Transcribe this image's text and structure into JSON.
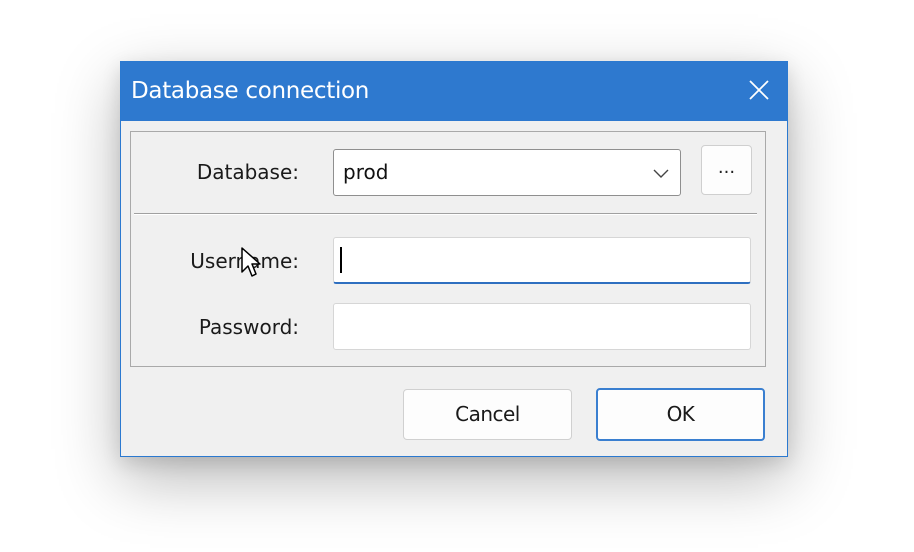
{
  "window": {
    "title": "Database connection",
    "close_icon": "close-icon",
    "accent_color": "#2e79cf"
  },
  "form": {
    "database_label": "Database:",
    "database_value": "prod",
    "database_dropdown_icon": "chevron-down-icon",
    "browse_label": "...",
    "username_label": "Username:",
    "username_value": "",
    "password_label": "Password:",
    "password_value": ""
  },
  "buttons": {
    "cancel_label": "Cancel",
    "ok_label": "OK"
  },
  "pointer": {
    "icon": "mouse-pointer-icon"
  }
}
